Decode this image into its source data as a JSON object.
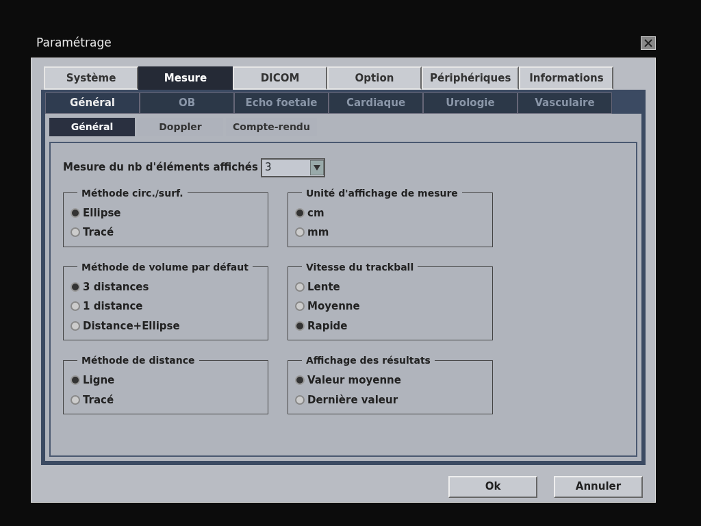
{
  "window": {
    "title": "Paramétrage"
  },
  "tabs": [
    {
      "label": "Système",
      "selected": false
    },
    {
      "label": "Mesure",
      "selected": true
    },
    {
      "label": "DICOM",
      "selected": false
    },
    {
      "label": "Option",
      "selected": false
    },
    {
      "label": "Périphériques",
      "selected": false
    },
    {
      "label": "Informations",
      "selected": false
    }
  ],
  "subtabs": [
    {
      "label": "Général",
      "selected": true
    },
    {
      "label": "OB",
      "selected": false
    },
    {
      "label": "Echo foetale",
      "selected": false
    },
    {
      "label": "Cardiaque",
      "selected": false
    },
    {
      "label": "Urologie",
      "selected": false
    },
    {
      "label": "Vasculaire",
      "selected": false
    }
  ],
  "section_tabs": [
    {
      "label": "Général",
      "selected": true
    },
    {
      "label": "Doppler",
      "selected": false
    },
    {
      "label": "Compte-rendu",
      "selected": false
    }
  ],
  "count_field": {
    "label": "Mesure du nb d'éléments affichés",
    "value": "3"
  },
  "groups": [
    {
      "title": "Méthode circ./surf.",
      "options": [
        {
          "label": "Ellipse",
          "selected": true
        },
        {
          "label": "Tracé",
          "selected": false
        }
      ]
    },
    {
      "title": "Unité d'affichage de mesure",
      "options": [
        {
          "label": "cm",
          "selected": true
        },
        {
          "label": "mm",
          "selected": false
        }
      ]
    },
    {
      "title": "Méthode de volume par défaut",
      "options": [
        {
          "label": "3 distances",
          "selected": true
        },
        {
          "label": "1 distance",
          "selected": false
        },
        {
          "label": "Distance+Ellipse",
          "selected": false
        }
      ]
    },
    {
      "title": "Vitesse du trackball",
      "options": [
        {
          "label": "Lente",
          "selected": false
        },
        {
          "label": "Moyenne",
          "selected": false
        },
        {
          "label": "Rapide",
          "selected": true
        }
      ]
    },
    {
      "title": "Méthode de distance",
      "options": [
        {
          "label": "Ligne",
          "selected": true
        },
        {
          "label": "Tracé",
          "selected": false
        }
      ]
    },
    {
      "title": "Affichage des résultats",
      "options": [
        {
          "label": "Valeur moyenne",
          "selected": true
        },
        {
          "label": "Dernière valeur",
          "selected": false
        }
      ]
    }
  ],
  "buttons": [
    "Ok",
    "Annuler"
  ]
}
